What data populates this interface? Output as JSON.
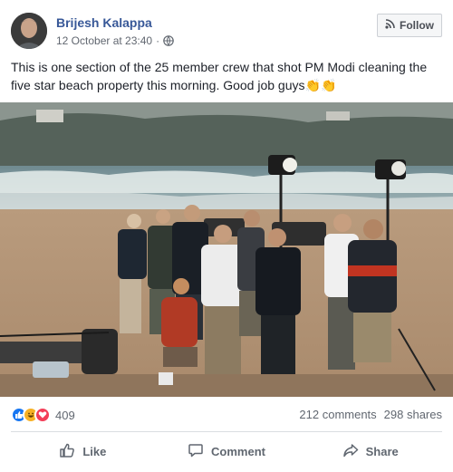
{
  "post": {
    "author": "Brijesh Kalappa",
    "timestamp": "12 October at 23:40",
    "separator": "·",
    "privacy_icon": "globe-icon",
    "follow_label": "Follow",
    "follow_icon": "rss-icon",
    "text": "This is one section of the 25 member crew that shot PM Modi cleaning the five star beach property this morning. Good job guys",
    "text_emoji": "👏👏"
  },
  "engagement": {
    "reaction_icons": [
      "like-icon",
      "haha-icon",
      "love-icon"
    ],
    "reaction_count": "409",
    "comments": "212 comments",
    "shares": "298 shares"
  },
  "actions": {
    "like_label": "Like",
    "comment_label": "Comment",
    "share_label": "Share"
  },
  "colors": {
    "author_link": "#385898",
    "like_blue": "#1877f2",
    "haha_yellow": "#f7b125",
    "love_red": "#f33e58"
  }
}
